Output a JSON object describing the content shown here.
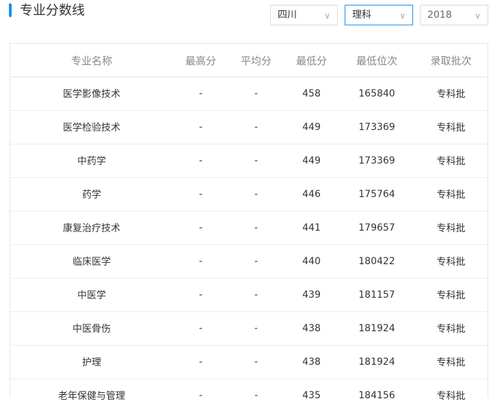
{
  "header": {
    "title": "专业分数线"
  },
  "filters": {
    "province": "四川",
    "subject": "理科",
    "year": "2018"
  },
  "table": {
    "columns": [
      "专业名称",
      "最高分",
      "平均分",
      "最低分",
      "最低位次",
      "录取批次"
    ],
    "rows": [
      [
        "医学影像技术",
        "-",
        "-",
        "458",
        "165840",
        "专科批"
      ],
      [
        "医学检验技术",
        "-",
        "-",
        "449",
        "173369",
        "专科批"
      ],
      [
        "中药学",
        "-",
        "-",
        "449",
        "173369",
        "专科批"
      ],
      [
        "药学",
        "-",
        "-",
        "446",
        "175764",
        "专科批"
      ],
      [
        "康复治疗技术",
        "-",
        "-",
        "441",
        "179657",
        "专科批"
      ],
      [
        "临床医学",
        "-",
        "-",
        "440",
        "180422",
        "专科批"
      ],
      [
        "中医学",
        "-",
        "-",
        "439",
        "181157",
        "专科批"
      ],
      [
        "中医骨伤",
        "-",
        "-",
        "438",
        "181924",
        "专科批"
      ],
      [
        "护理",
        "-",
        "-",
        "438",
        "181924",
        "专科批"
      ],
      [
        "老年保健与管理",
        "-",
        "-",
        "435",
        "184156",
        "专科批"
      ]
    ]
  }
}
